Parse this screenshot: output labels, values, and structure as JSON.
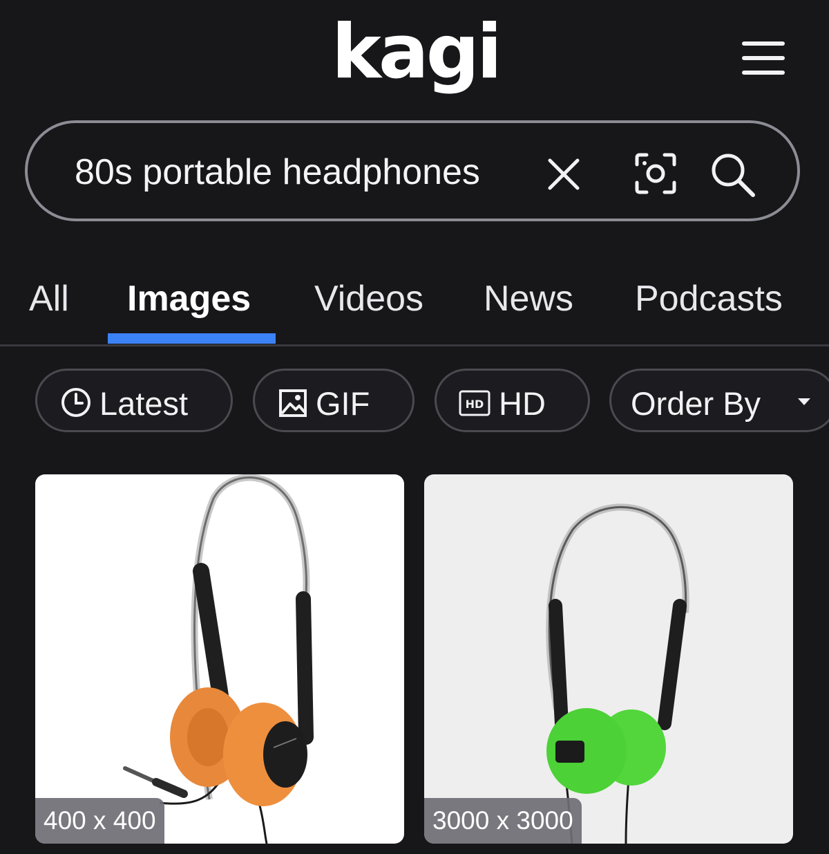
{
  "header": {
    "logo_text": "kagi",
    "menu_icon": "hamburger-menu-icon"
  },
  "search": {
    "query": "80s portable headphones",
    "clear_icon": "close-icon",
    "camera_icon": "image-search-icon",
    "search_icon": "search-icon"
  },
  "tabs": [
    {
      "label": "All",
      "active": false
    },
    {
      "label": "Images",
      "active": true
    },
    {
      "label": "Videos",
      "active": false
    },
    {
      "label": "News",
      "active": false
    },
    {
      "label": "Podcasts",
      "active": false
    }
  ],
  "filters": [
    {
      "label": "Latest",
      "icon": "clock-icon"
    },
    {
      "label": "GIF",
      "icon": "image-icon"
    },
    {
      "label": "HD",
      "icon": "hd-icon"
    },
    {
      "label": "Order By",
      "icon": "caret-down-icon"
    }
  ],
  "colors": {
    "background": "#17171a",
    "accent": "#3b82f6",
    "chip_border": "#4a4a50"
  },
  "results": [
    {
      "dimensions": "400 x 400",
      "ear_pad_color": "#e8883a",
      "background": "#ffffff"
    },
    {
      "dimensions": "3000 x 3000",
      "ear_pad_color": "#4cd137",
      "background": "#eeeeee"
    }
  ]
}
